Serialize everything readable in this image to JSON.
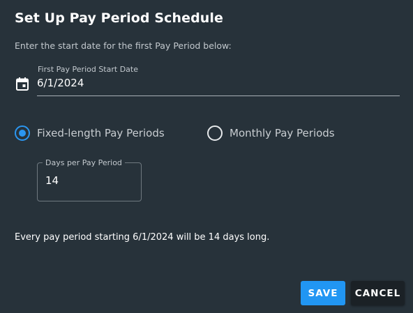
{
  "dialog": {
    "title": "Set Up Pay Period Schedule",
    "instruction": "Enter the start date for the first Pay Period below:"
  },
  "start_date_field": {
    "label": "First Pay Period Start Date",
    "value": "6/1/2024",
    "icon": "calendar-icon"
  },
  "period_type": {
    "options": [
      {
        "label": "Fixed-length Pay Periods",
        "selected": true
      },
      {
        "label": "Monthly Pay Periods",
        "selected": false
      }
    ]
  },
  "days_field": {
    "label": "Days per Pay Period",
    "value": "14"
  },
  "summary": "Every pay period starting 6/1/2024 will be 14 days long.",
  "buttons": {
    "save": "SAVE",
    "cancel": "CANCEL"
  },
  "colors": {
    "background": "#27323a",
    "accent": "#2196f3",
    "cancel_background": "#1b2126"
  }
}
